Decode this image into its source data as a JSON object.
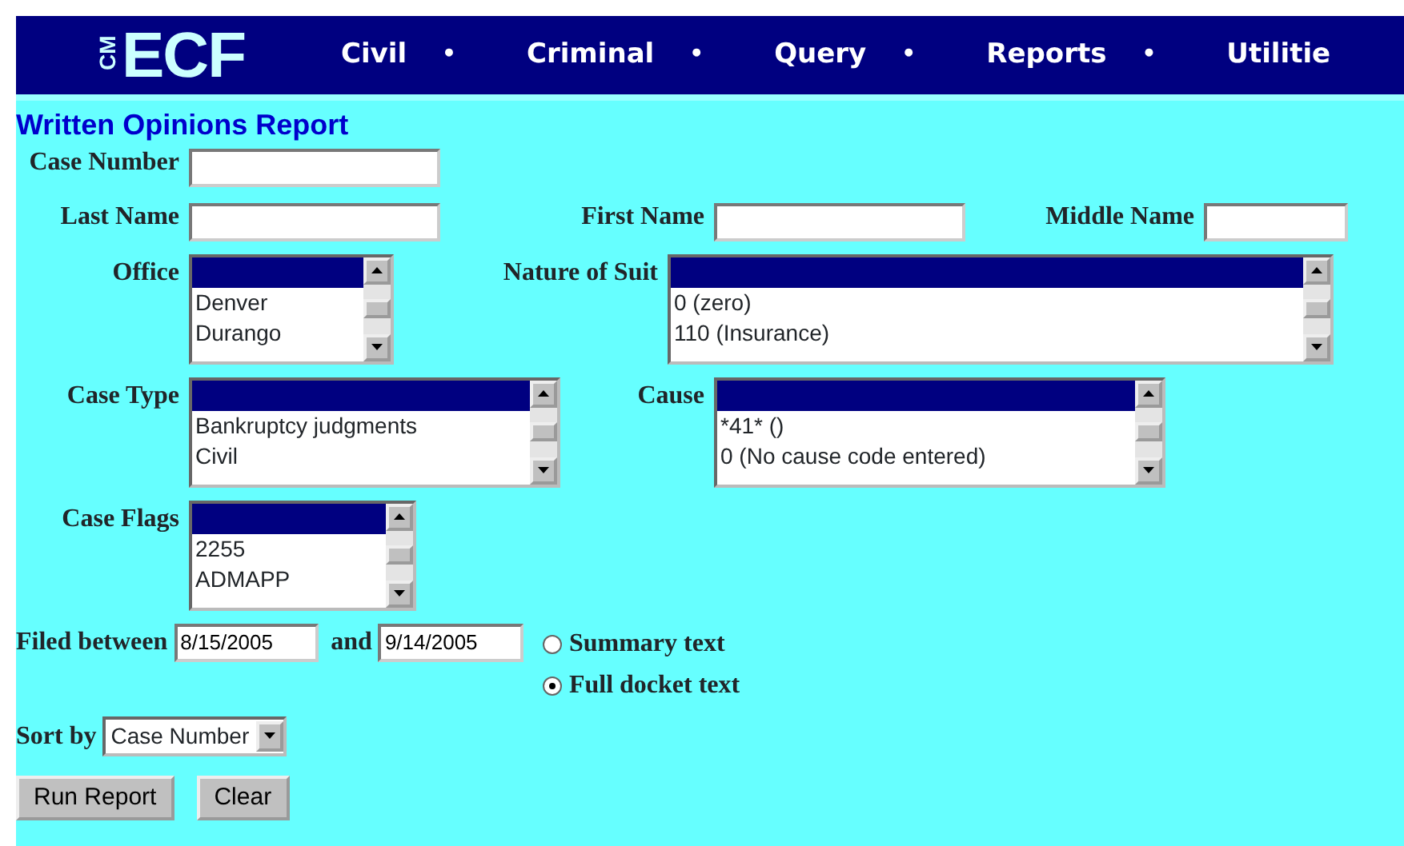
{
  "logo": {
    "small": "CM",
    "large": "ECF"
  },
  "nav": [
    {
      "label": "Civil",
      "separator": "•"
    },
    {
      "label": "Criminal",
      "separator": "•"
    },
    {
      "label": "Query",
      "separator": "•"
    },
    {
      "label": "Reports",
      "separator": "•"
    },
    {
      "label": "Utilitie"
    }
  ],
  "title": "Written Opinions Report",
  "case_number": {
    "label": "Case Number"
  },
  "names": [
    {
      "label": "Last Name"
    },
    {
      "label": "First Name"
    },
    {
      "label": "Middle Name"
    }
  ],
  "listbox_rows": [
    [
      {
        "label": "Office",
        "options": [
          {
            "selected": true
          },
          {
            "label": "Denver",
            "selected": false
          },
          {
            "label": "Durango",
            "selected": false
          }
        ]
      },
      {
        "label": "Nature of Suit",
        "options": [
          {
            "selected": true
          },
          {
            "label": "0 (zero)",
            "selected": false
          },
          {
            "label": "110 (Insurance)",
            "selected": false
          }
        ]
      }
    ],
    [
      {
        "label": "Case Type",
        "options": [
          {
            "selected": true
          },
          {
            "label": "Bankruptcy judgments",
            "selected": false
          },
          {
            "label": "Civil",
            "selected": false
          }
        ]
      },
      {
        "label": "Cause",
        "options": [
          {
            "selected": true
          },
          {
            "label": "*41* ()",
            "selected": false
          },
          {
            "label": "0 (No cause code entered)",
            "selected": false
          }
        ]
      }
    ],
    [
      {
        "label": "Case Flags",
        "options": [
          {
            "selected": true
          },
          {
            "label": "2255",
            "selected": false
          },
          {
            "label": "ADMAPP",
            "selected": false
          }
        ]
      }
    ]
  ],
  "filed": {
    "label": "Filed between",
    "from": "8/15/2005",
    "joiner": "and",
    "to": "9/14/2005"
  },
  "text_options": [
    {
      "label": "Summary text",
      "selected": false
    },
    {
      "label": "Full docket text",
      "selected": true
    }
  ],
  "sort": {
    "label": "Sort by",
    "value": "Case Number"
  },
  "buttons": [
    "Run Report",
    "Clear"
  ]
}
